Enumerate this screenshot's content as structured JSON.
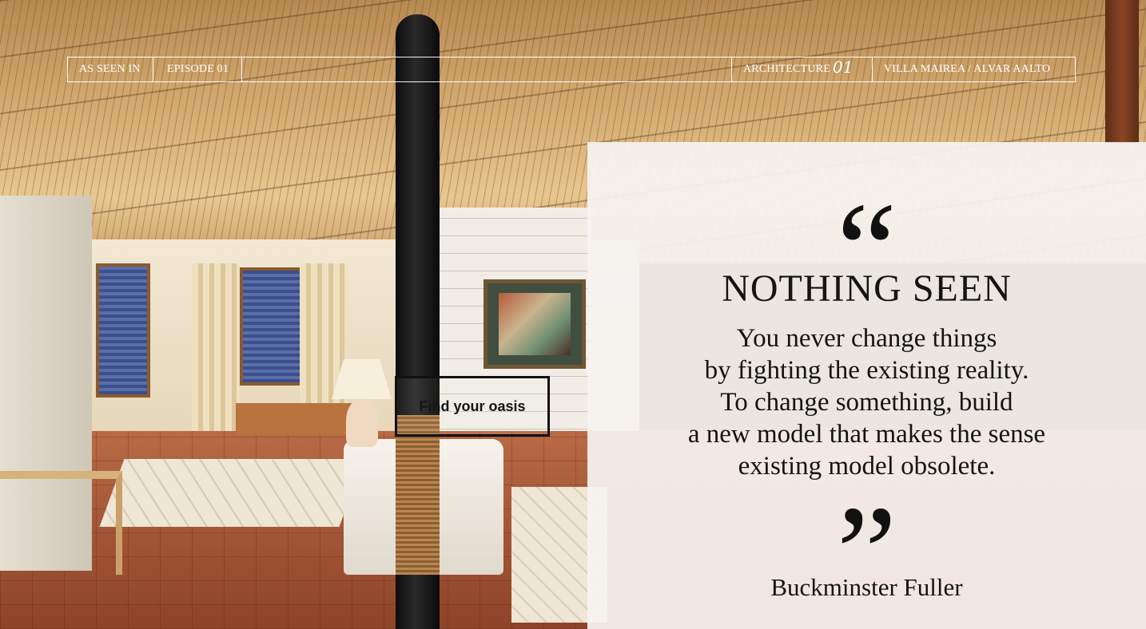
{
  "nav": {
    "as_seen_in": "AS SEEN IN",
    "episode": "EPISODE 01",
    "category": "ARCHITECTURE",
    "category_number": "01",
    "project": "VILLA MAIREA / ALVAR AALTO"
  },
  "cta": {
    "label": "Find your oasis"
  },
  "quote": {
    "open_mark": "“",
    "heading": "NOTHING SEEN",
    "lines": [
      "You never change things",
      "by fighting the existing reality.",
      "To change something, build",
      "a new model that makes the sense",
      "existing model obsolete."
    ],
    "close_mark": "”",
    "author": "Buckminster Fuller"
  },
  "colors": {
    "nav_text": "#ffffff",
    "panel_bg": "#f6f3f1",
    "text_dark": "#141414",
    "cta_border": "#111111"
  }
}
